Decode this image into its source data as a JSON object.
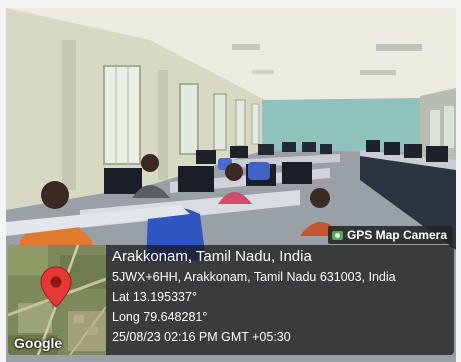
{
  "badge": {
    "label": "GPS Map Camera"
  },
  "location": {
    "title": "Arakkonam, Tamil Nadu, India",
    "address": "5JWX+6HH, Arakkonam, Tamil Nadu 631003, India",
    "lat": "Lat 13.195337°",
    "long": "Long 79.648281°",
    "datetime": "25/08/23 02:16 PM GMT +05:30"
  },
  "map": {
    "attribution": "Google",
    "marker_color": "#e53935"
  },
  "colors": {
    "overlay_bg": "#141414",
    "wall": "#d8d9c2",
    "ceiling": "#ecebdf",
    "floor": "#9aa1a6"
  }
}
